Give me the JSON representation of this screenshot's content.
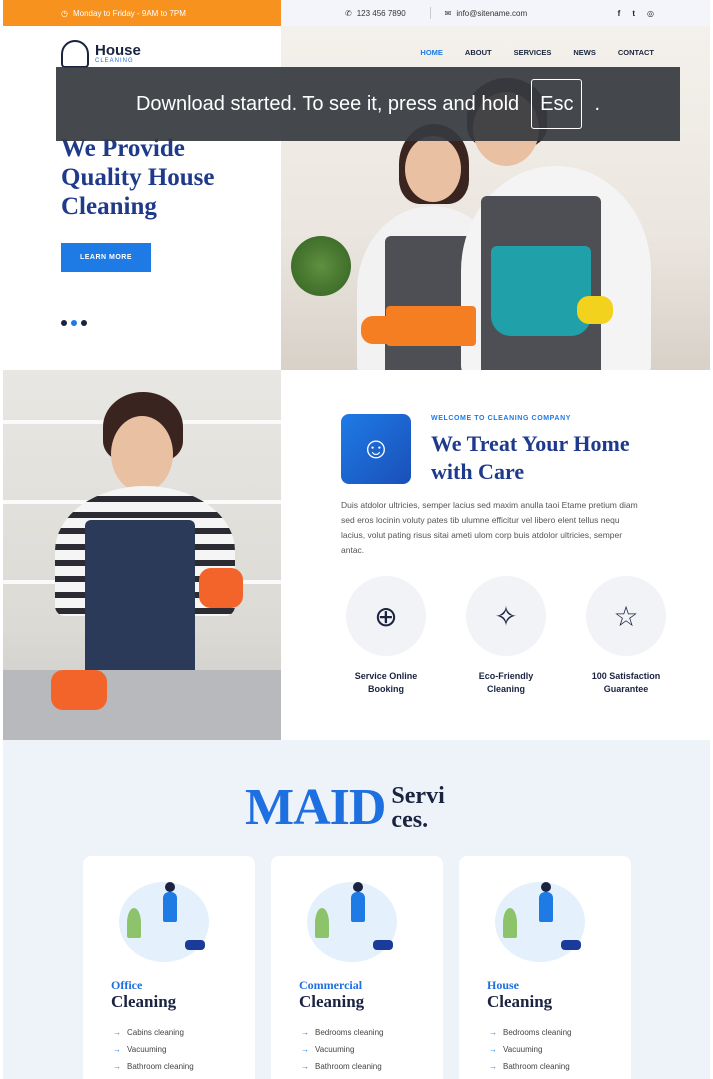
{
  "topbar": {
    "hours_icon": "clock-icon",
    "hours": "Monday to Friday - 9AM to 7PM",
    "phone_icon": "phone-icon",
    "phone": "123 456 7890",
    "email_icon": "envelope-icon",
    "email": "info@sitename.com",
    "social": [
      "f",
      "t",
      "◎"
    ]
  },
  "logo": {
    "title": "House",
    "subtitle": "CLEANING"
  },
  "nav": {
    "items": [
      "HOME",
      "ABOUT",
      "SERVICES",
      "NEWS",
      "CONTACT"
    ],
    "active": "HOME"
  },
  "hero": {
    "title": "We Provide Quality House Cleaning",
    "button": "LEARN MORE",
    "slides": 3,
    "active_slide": 2
  },
  "toast": {
    "message": "Download started. To see it, press and hold",
    "key": "Esc",
    "suffix": "."
  },
  "about": {
    "eyebrow": "WELCOME TO CLEANING COMPANY",
    "title": "We Treat Your Home with Care",
    "text": "Duis atdolor ultricies, semper lacius sed maxim anulla taoi Etame pretium diam sed eros locinin voluty pates tib ulumne efficitur vel libero elent tellus nequ lacius, volut pating risus sitai ameti ulom corp buis atdolor ultricies, semper antac.",
    "features": [
      {
        "label_1": "Service Online",
        "label_2": "Booking",
        "icon": "globe-person-icon"
      },
      {
        "label_1": "Eco-Friendly",
        "label_2": "Cleaning",
        "icon": "broom-icon"
      },
      {
        "label_1": "100 Satisfaction",
        "label_2": "Guarantee",
        "icon": "thumbs-up-star-icon"
      }
    ]
  },
  "services": {
    "heading_big": "MAID",
    "heading_small": "Servi ces.",
    "cards": [
      {
        "sub": "Office",
        "title": "Cleaning",
        "items": [
          "Cabins cleaning",
          "Vacuuming",
          "Bathroom cleaning"
        ]
      },
      {
        "sub": "Commercial",
        "title": "Cleaning",
        "items": [
          "Bedrooms cleaning",
          "Vacuuming",
          "Bathroom cleaning"
        ]
      },
      {
        "sub": "House",
        "title": "Cleaning",
        "items": [
          "Bedrooms cleaning",
          "Vacuuming",
          "Bathroom cleaning"
        ]
      }
    ]
  },
  "colors": {
    "brand_blue": "#1e7be6",
    "navy": "#1f3a8a",
    "orange": "#f7921e"
  }
}
